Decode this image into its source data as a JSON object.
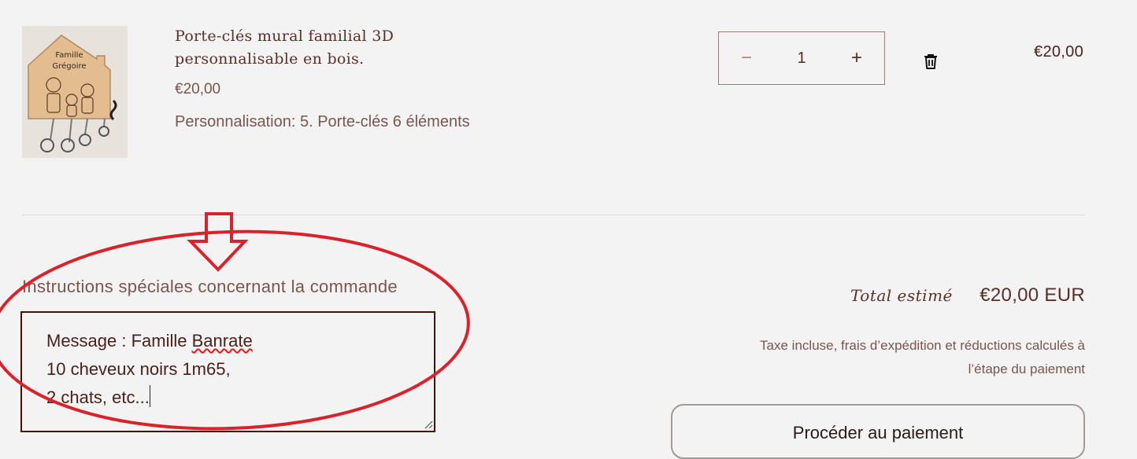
{
  "product": {
    "image_alt": "Porte-clés mural bois",
    "image_text_line1": "Famille",
    "image_text_line2": "Grégoire",
    "title_line1": "Porte-clés mural familial 3D",
    "title_line2": "personnalisable en bois.",
    "unit_price": "€20,00",
    "variant": "Personnalisation: 5. Porte-clés 6 éléments",
    "quantity": "1",
    "minus_label": "−",
    "plus_label": "+",
    "line_total": "€20,00",
    "delete_icon": "trash-icon"
  },
  "instructions": {
    "label": "Instructions spéciales concernant la commande",
    "line1_prefix": "Message : Famille ",
    "line1_misspelled": "Banrate",
    "line2": "10 cheveux noirs 1m65,",
    "line3": "2 chats, etc..."
  },
  "annotation": {
    "color": "#d8232a",
    "shapes": [
      "down-arrow",
      "ellipse"
    ]
  },
  "summary": {
    "total_label": "Total estimé",
    "total_value": "€20,00 EUR",
    "tax_line1": "Taxe incluse, frais d’expédition et réductions calculés à",
    "tax_line2": "l’étape du paiement",
    "checkout_label": "Procéder au paiement"
  },
  "colors": {
    "background": "#f3f3f3",
    "text_brand": "#5b2f28",
    "textarea_border": "#4a0d08"
  }
}
